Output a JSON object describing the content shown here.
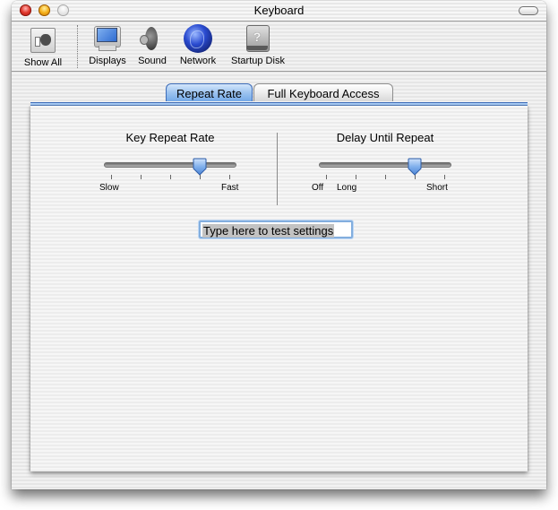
{
  "window": {
    "title": "Keyboard"
  },
  "toolbar": {
    "items": [
      {
        "label": "Show All",
        "icon": "show-all-icon"
      },
      {
        "label": "Displays",
        "icon": "displays-icon"
      },
      {
        "label": "Sound",
        "icon": "sound-icon"
      },
      {
        "label": "Network",
        "icon": "network-icon"
      },
      {
        "label": "Startup Disk",
        "icon": "startup-disk-icon"
      }
    ]
  },
  "tabs": [
    {
      "label": "Repeat Rate",
      "selected": true
    },
    {
      "label": "Full Keyboard Access",
      "selected": false
    }
  ],
  "repeat_rate": {
    "title": "Key Repeat Rate",
    "value_fraction": 0.75,
    "tick_count": 5,
    "min_label": "Slow",
    "max_label": "Fast"
  },
  "delay": {
    "title": "Delay Until Repeat",
    "value_fraction": 0.75,
    "tick_count": 5,
    "off_label": "Off",
    "min_label": "Long",
    "max_label": "Short"
  },
  "test_field": {
    "value": "Type here to test settings",
    "text_selected": true
  },
  "colors": {
    "accent": "#74a9e8",
    "close": "#e0372c",
    "minimize": "#f5b01a"
  }
}
